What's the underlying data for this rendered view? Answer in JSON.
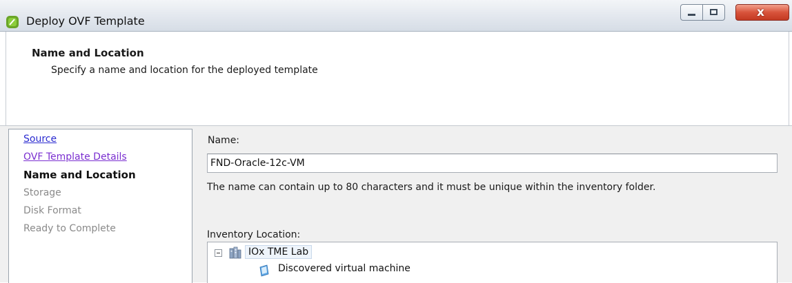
{
  "window": {
    "title": "Deploy OVF Template",
    "icon": "vsphere-app-icon",
    "controls": {
      "minimize": "minimize-icon",
      "maximize": "maximize-icon",
      "close_glyph": "x"
    }
  },
  "header": {
    "title": "Name and Location",
    "subtitle": "Specify a name and location for the deployed template"
  },
  "nav": {
    "items": [
      {
        "label": "Source",
        "state": "link"
      },
      {
        "label": "OVF Template Details",
        "state": "visited-link"
      },
      {
        "label": "Name and Location",
        "state": "current"
      },
      {
        "label": "Storage",
        "state": "disabled"
      },
      {
        "label": "Disk Format",
        "state": "disabled"
      },
      {
        "label": "Ready to Complete",
        "state": "disabled"
      }
    ]
  },
  "form": {
    "name_label": "Name:",
    "name_value": "FND-Oracle-12c-VM",
    "hint": "The name can contain up to 80 characters and it must be unique within the inventory folder.",
    "inventory_label": "Inventory Location:",
    "tree": {
      "root": {
        "label": "IOx TME Lab",
        "icon": "datacenter-icon",
        "expanded": true
      },
      "children": [
        {
          "label": "Discovered virtual machine",
          "icon": "folder-icon"
        }
      ]
    }
  },
  "colors": {
    "link": "#2a2ad0",
    "visited_link": "#7a2ed0",
    "disabled_text": "#8a8a8a",
    "panel_bg": "#f0f0f0",
    "close_button": "#d8533b"
  }
}
